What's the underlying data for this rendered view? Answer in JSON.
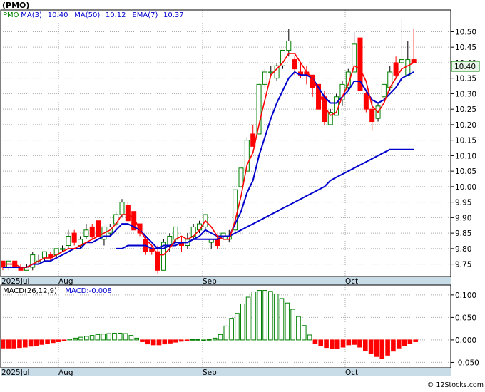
{
  "title": "(PMO)",
  "legend_main": [
    {
      "text": "PMO",
      "color": "#008000"
    },
    {
      "text": "MA(3)",
      "color": "#0000cc"
    },
    {
      "text": "10.40",
      "color": "#0000cc"
    },
    {
      "text": "MA(50)",
      "color": "#0000cc"
    },
    {
      "text": "10.12",
      "color": "#0000cc"
    },
    {
      "text": "EMA(7)",
      "color": "#0000cc"
    },
    {
      "text": "10.37",
      "color": "#0000cc"
    }
  ],
  "legend_macd": [
    {
      "text": "MACD(26,12,9)",
      "color": "#000000"
    },
    {
      "text": "MACD:-0.008",
      "color": "#0000cc"
    }
  ],
  "last_price_label": "10.40",
  "watermark": "© 12Stocks.com",
  "colors": {
    "up": "#008000",
    "down": "#ff0000",
    "ma3": "#ff0000",
    "ema7": "#0000cc",
    "ma50": "#0000cc",
    "axis_band": "#c8dce8",
    "grid": "#aaaaaa"
  },
  "chart_data": [
    {
      "type": "candlestick",
      "x_labels": [
        "2025Jul",
        "Aug",
        "Sep",
        "Oct"
      ],
      "y_ticks": [
        9.75,
        9.8,
        9.85,
        9.9,
        9.95,
        10.0,
        10.05,
        10.1,
        10.15,
        10.2,
        10.25,
        10.3,
        10.35,
        10.4,
        10.45,
        10.5
      ],
      "ylim": [
        9.71,
        10.57
      ],
      "candles": [
        [
          9.76,
          9.76,
          9.73,
          9.74
        ],
        [
          9.74,
          9.76,
          9.73,
          9.76
        ],
        [
          9.76,
          9.76,
          9.74,
          9.74
        ],
        [
          9.74,
          9.75,
          9.73,
          9.73
        ],
        [
          9.73,
          9.75,
          9.73,
          9.74
        ],
        [
          9.74,
          9.79,
          9.73,
          9.78
        ],
        [
          9.76,
          9.78,
          9.75,
          9.76
        ],
        [
          9.77,
          9.79,
          9.76,
          9.79
        ],
        [
          9.78,
          9.79,
          9.76,
          9.77
        ],
        [
          9.78,
          9.8,
          9.77,
          9.8
        ],
        [
          9.8,
          9.81,
          9.79,
          9.8
        ],
        [
          9.81,
          9.86,
          9.8,
          9.84
        ],
        [
          9.85,
          9.86,
          9.81,
          9.82
        ],
        [
          9.81,
          9.84,
          9.8,
          9.83
        ],
        [
          9.84,
          9.88,
          9.83,
          9.86
        ],
        [
          9.87,
          9.88,
          9.83,
          9.84
        ],
        [
          9.89,
          9.89,
          9.83,
          9.84
        ],
        [
          9.83,
          9.86,
          9.81,
          9.87
        ],
        [
          9.85,
          9.88,
          9.84,
          9.87
        ],
        [
          9.88,
          9.92,
          9.86,
          9.91
        ],
        [
          9.91,
          9.96,
          9.9,
          9.95
        ],
        [
          9.94,
          9.95,
          9.89,
          9.89
        ],
        [
          9.92,
          9.92,
          9.86,
          9.86
        ],
        [
          9.88,
          9.88,
          9.84,
          9.85
        ],
        [
          9.83,
          9.84,
          9.78,
          9.79
        ],
        [
          9.8,
          9.81,
          9.78,
          9.79
        ],
        [
          9.79,
          9.81,
          9.72,
          9.73
        ],
        [
          9.73,
          9.83,
          9.73,
          9.82
        ],
        [
          9.81,
          9.85,
          9.79,
          9.84
        ],
        [
          9.83,
          9.87,
          9.82,
          9.87
        ],
        [
          9.82,
          9.84,
          9.79,
          9.81
        ],
        [
          9.81,
          9.85,
          9.8,
          9.83
        ],
        [
          9.84,
          9.88,
          9.83,
          9.87
        ],
        [
          9.86,
          9.89,
          9.85,
          9.88
        ],
        [
          9.87,
          9.91,
          9.86,
          9.91
        ],
        [
          9.82,
          9.83,
          9.8,
          9.83
        ],
        [
          9.83,
          9.84,
          9.8,
          9.81
        ],
        [
          9.84,
          9.85,
          9.83,
          9.85
        ],
        [
          9.83,
          9.86,
          9.82,
          9.84
        ],
        [
          9.86,
          9.99,
          9.85,
          9.99
        ],
        [
          10.0,
          10.06,
          10.0,
          10.06
        ],
        [
          10.05,
          10.16,
          10.05,
          10.15
        ],
        [
          10.17,
          10.2,
          10.13,
          10.13
        ],
        [
          10.17,
          10.33,
          10.17,
          10.33
        ],
        [
          10.33,
          10.38,
          10.32,
          10.37
        ],
        [
          10.37,
          10.39,
          10.36,
          10.37
        ],
        [
          10.35,
          10.4,
          10.34,
          10.39
        ],
        [
          10.39,
          10.44,
          10.38,
          10.44
        ],
        [
          10.44,
          10.51,
          10.42,
          10.47
        ],
        [
          10.41,
          10.42,
          10.36,
          10.38
        ],
        [
          10.37,
          10.4,
          10.35,
          10.36
        ],
        [
          10.37,
          10.39,
          10.33,
          10.36
        ],
        [
          10.36,
          10.36,
          10.29,
          10.32
        ],
        [
          10.33,
          10.33,
          10.25,
          10.25
        ],
        [
          10.29,
          10.31,
          10.2,
          10.21
        ],
        [
          10.2,
          10.25,
          10.2,
          10.24
        ],
        [
          10.23,
          10.3,
          10.23,
          10.29
        ],
        [
          10.28,
          10.34,
          10.26,
          10.33
        ],
        [
          10.32,
          10.38,
          10.31,
          10.37
        ],
        [
          10.37,
          10.5,
          10.37,
          10.46
        ],
        [
          10.48,
          10.48,
          10.31,
          10.31
        ],
        [
          10.3,
          10.31,
          10.24,
          10.25
        ],
        [
          10.25,
          10.28,
          10.18,
          10.21
        ],
        [
          10.22,
          10.27,
          10.21,
          10.26
        ],
        [
          10.29,
          10.33,
          10.28,
          10.33
        ],
        [
          10.32,
          10.39,
          10.31,
          10.37
        ],
        [
          10.4,
          10.42,
          10.35,
          10.36
        ],
        [
          10.4,
          10.54,
          10.33,
          10.41
        ],
        [
          10.36,
          10.47,
          10.36,
          10.41
        ],
        [
          10.41,
          10.51,
          10.4,
          10.4
        ]
      ],
      "ma3": [
        9.75,
        9.75,
        9.75,
        9.74,
        9.74,
        9.75,
        9.76,
        9.77,
        9.77,
        9.78,
        9.79,
        9.8,
        9.8,
        9.81,
        9.82,
        9.83,
        9.84,
        9.85,
        9.86,
        9.88,
        9.91,
        9.91,
        9.9,
        9.86,
        9.83,
        9.81,
        9.78,
        9.78,
        9.8,
        9.83,
        9.84,
        9.83,
        9.84,
        9.86,
        9.89,
        9.87,
        9.84,
        9.83,
        9.83,
        9.89,
        9.97,
        10.07,
        10.11,
        10.2,
        10.28,
        10.36,
        10.38,
        10.4,
        10.43,
        10.43,
        10.4,
        10.37,
        10.35,
        10.31,
        10.26,
        10.23,
        10.24,
        10.29,
        10.33,
        10.39,
        10.38,
        10.34,
        10.26,
        10.24,
        10.27,
        10.32,
        10.35,
        10.38,
        10.39,
        10.4
      ],
      "ema7": [
        9.74,
        9.74,
        9.74,
        9.74,
        9.74,
        9.75,
        9.75,
        9.76,
        9.76,
        9.77,
        9.78,
        9.79,
        9.8,
        9.8,
        9.82,
        9.82,
        9.83,
        9.84,
        9.84,
        9.86,
        9.88,
        9.88,
        9.87,
        9.86,
        9.84,
        9.82,
        9.8,
        9.8,
        9.81,
        9.82,
        9.82,
        9.82,
        9.83,
        9.84,
        9.86,
        9.85,
        9.84,
        9.84,
        9.84,
        9.88,
        9.92,
        9.98,
        10.02,
        10.1,
        10.16,
        10.22,
        10.27,
        10.31,
        10.35,
        10.37,
        10.36,
        10.36,
        10.35,
        10.32,
        10.29,
        10.27,
        10.27,
        10.29,
        10.31,
        10.34,
        10.34,
        10.31,
        10.28,
        10.27,
        10.28,
        10.3,
        10.32,
        10.35,
        10.36,
        10.37
      ],
      "ma50_start": 19,
      "ma50": [
        9.8,
        9.8,
        9.81,
        9.81,
        9.81,
        9.81,
        9.8,
        9.8,
        9.81,
        9.81,
        9.81,
        9.82,
        9.82,
        9.83,
        9.83,
        9.83,
        9.83,
        9.83,
        9.84,
        9.84,
        9.85,
        9.86,
        9.87,
        9.88,
        9.89,
        9.9,
        9.91,
        9.92,
        9.93,
        9.94,
        9.95,
        9.96,
        9.97,
        9.98,
        9.99,
        10.0,
        10.02,
        10.03,
        10.04,
        10.05,
        10.06,
        10.07,
        10.08,
        10.09,
        10.1,
        10.11,
        10.12,
        10.12,
        10.12,
        10.12,
        10.12
      ]
    },
    {
      "type": "bar",
      "name": "MACD(26,12,9)",
      "y_ticks": [
        0.1,
        0.05,
        0.0,
        -0.05
      ],
      "ylim": [
        -0.062,
        0.122
      ],
      "values": [
        -0.018,
        -0.018,
        -0.018,
        -0.017,
        -0.016,
        -0.014,
        -0.012,
        -0.01,
        -0.008,
        -0.006,
        -0.004,
        -0.001,
        0.002,
        0.004,
        0.006,
        0.008,
        0.01,
        0.012,
        0.013,
        0.014,
        0.015,
        0.015,
        0.014,
        0.01,
        0.004,
        -0.004,
        -0.009,
        -0.011,
        -0.011,
        -0.009,
        -0.007,
        -0.005,
        -0.003,
        -0.001,
        0.001,
        0.001,
        0.0,
        0.001,
        0.004,
        0.012,
        0.031,
        0.048,
        0.059,
        0.08,
        0.095,
        0.107,
        0.11,
        0.11,
        0.108,
        0.102,
        0.092,
        0.082,
        0.068,
        0.052,
        0.032,
        0.011,
        -0.008,
        -0.013,
        -0.017,
        -0.019,
        -0.019,
        -0.016,
        -0.011,
        -0.01,
        -0.016,
        -0.024,
        -0.031,
        -0.037,
        -0.041,
        -0.034,
        -0.025,
        -0.018,
        -0.013,
        -0.008,
        -0.004
      ]
    }
  ]
}
